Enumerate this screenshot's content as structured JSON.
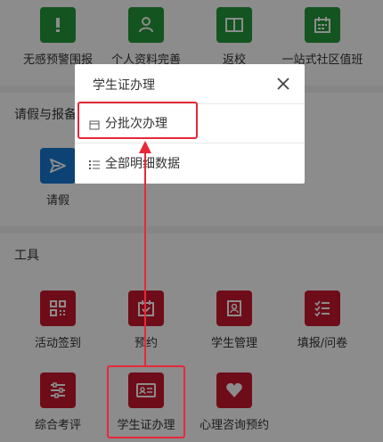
{
  "top_apps": [
    {
      "label": "无感预警围报",
      "icon": "exclamation-icon"
    },
    {
      "label": "个人资料完善",
      "icon": "person-icon"
    },
    {
      "label": "返校",
      "icon": "book-icon"
    },
    {
      "label": "一站式社区值班",
      "icon": "calendar-icon"
    }
  ],
  "section_leave": {
    "title": "请假与报备",
    "apps": [
      {
        "label": "请假",
        "icon": "send-icon"
      }
    ]
  },
  "section_tools": {
    "title": "工具",
    "apps": [
      {
        "label": "活动签到",
        "icon": "qr-icon"
      },
      {
        "label": "预约",
        "icon": "calendar-check-icon"
      },
      {
        "label": "学生管理",
        "icon": "contact-book-icon"
      },
      {
        "label": "填报/问卷",
        "icon": "checklist-icon"
      },
      {
        "label": "综合考评",
        "icon": "sliders-icon"
      },
      {
        "label": "学生证办理",
        "icon": "id-card-icon"
      },
      {
        "label": "心理咨询预约",
        "icon": "heart-icon"
      }
    ]
  },
  "modal": {
    "title": "学生证办理",
    "items": [
      {
        "label": "分批次办理",
        "icon": "calendar-small-icon"
      },
      {
        "label": "全部明细数据",
        "icon": "list-icon"
      }
    ]
  },
  "colors": {
    "green": "#239a3b",
    "blue": "#1978d4",
    "red": "#c9192e",
    "annotation": "#e8283a"
  }
}
